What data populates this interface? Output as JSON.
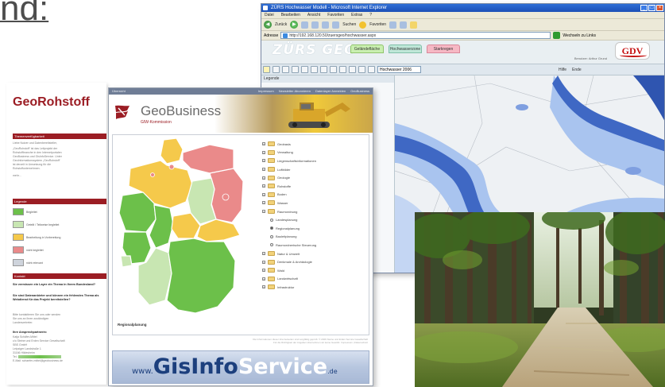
{
  "slide": {
    "heading_fragment": "nd:"
  },
  "zurs_window": {
    "title": "ZÜRS Hochwasser Modell - Microsoft Internet Explorer",
    "menu": [
      "Datei",
      "Bearbeiten",
      "Ansicht",
      "Favoriten",
      "Extras",
      "?"
    ],
    "toolbar": {
      "back_label": "Zurück",
      "search_label": "Suchen",
      "favorites_label": "Favoriten"
    },
    "address": {
      "label": "Adresse",
      "value": "http://192.168.120.50/zuersgeo/hochwasser.aspx",
      "links_label": "Wechseln zu  Links"
    },
    "app": {
      "logo": "ZÜRS GEO",
      "tabs": [
        "Geländefläche",
        "Hochwasserzone",
        "Starkregen"
      ],
      "partner_logo": "GDV",
      "user_text": "Benutzer: Arthur Grund"
    },
    "layer_select": "Hochwasser 2006",
    "panel_label": "Legende",
    "nav_labels": [
      "Hilfe",
      "Ende"
    ]
  },
  "georohstoff": {
    "brand": "GeoRohstoff",
    "sections": {
      "info_title": "Themenverfügbarkeit",
      "info_lines": [
        "Liebe Nutzer und Datenbereitsteller,",
        "„GeoRohstoff“ ist das Leitprojekt der",
        "Rohstoffbranche in den Internetportalen",
        "GeoBusiness und GisInfoService. Unter",
        "GeoInformationssystem „GeoRohstoff“",
        "ist derzeit in Umsetzung für die",
        "Rohstoffunternehmen."
      ],
      "more_link": "mehr...",
      "legend_title": "Legende",
      "legend": [
        {
          "label": "Begleitet",
          "color": "#6cc04a"
        },
        {
          "label": "Geteilt / Teilweise begleitet",
          "color": "#c8e6b2"
        },
        {
          "label": "Bearbeitung in Vorbereitung",
          "color": "#f5c94b"
        },
        {
          "label": "nicht begleitet",
          "color": "#ea8a8a"
        },
        {
          "label": "nicht relevant",
          "color": "#cfd4dc"
        }
      ],
      "contact_title": "Kontakt",
      "contact_q1": "Sie vermissen ein Layer ein Thema in Ihrem Bundesland?",
      "contact_q2": "Sie sind Datenanbieter und können ein fehlendes Thema als Webdienst für das Projekt bereitstellen?",
      "contact_lines": [
        "Bitte kontaktieren Sie uns oder senden",
        "Sie uns an Ihren zuständigen",
        "Landesvertreter."
      ],
      "partner_title": "Ihre Ansprechpartnerin:",
      "partner_lines": [
        "Katja Schäfer-Mittel",
        "c/o Steine und Erden Service Gesellschaft",
        "SBS GmbH",
        "Leipziger Landstraße 1",
        "31166 Hildesheim",
        "Tel.:",
        "E-Mail: schaefer-mittel@geobusiness.de"
      ]
    }
  },
  "geobusiness": {
    "topbar_left": "Übersicht",
    "topbar_right": [
      "Impressum",
      "Newsletter Abonnieren",
      "Datenlayer Anmelden",
      "GeoBusiness"
    ],
    "name": "GeoBusiness",
    "subtitle": "GIW-Kommission",
    "map_caption": "Regionalplanung",
    "tree": [
      {
        "label": "Geobasis",
        "level": 0
      },
      {
        "label": "Verwaltung",
        "level": 0
      },
      {
        "label": "Liegenschaftsinformationen",
        "level": 0
      },
      {
        "label": "Luftbilder",
        "level": 0
      },
      {
        "label": "Geologie",
        "level": 0
      },
      {
        "label": "Rohstoffe",
        "level": 0
      },
      {
        "label": "Boden",
        "level": 0
      },
      {
        "label": "Wasser",
        "level": 0
      },
      {
        "label": "Raumordnung",
        "level": 0
      },
      {
        "label": "Landesplanung",
        "level": 1,
        "checked": false
      },
      {
        "label": "Regionalplanung",
        "level": 1,
        "checked": true
      },
      {
        "label": "Bauleitplanung",
        "level": 1,
        "checked": false
      },
      {
        "label": "Raumordnerische Steuerung",
        "level": 1,
        "checked": false
      },
      {
        "label": "Natur & Umwelt",
        "level": 0
      },
      {
        "label": "Denkmale & Archäologie",
        "level": 0
      },
      {
        "label": "Wald",
        "level": 0
      },
      {
        "label": "Landwirtschaft",
        "level": 0
      },
      {
        "label": "Infrastruktur",
        "level": 0
      }
    ],
    "footer": [
      "Die Informationen dieser Internetseiten sind sorgfältig geprüft. © 2006 Steine und Erden Service Gesellschaft",
      "Für die Richtigkeit der Angaben übernehmen wir keine Gewähr. Impressum | Datenschutz"
    ],
    "banner": {
      "www": "www.",
      "info": "GisInfo",
      "service": "Service",
      "tld": ".de"
    }
  },
  "colors": {
    "geo_red": "#9b1d24",
    "state_green": "#6cc04a",
    "state_light_green": "#c8e6b2",
    "state_yellow": "#f5c94b",
    "state_red": "#ea8a8a",
    "flood_dark": "#3f68c4",
    "flood_light": "#a9c4ef"
  },
  "icons": [
    "shield-logo-icon",
    "folder-icon",
    "plus-expander-icon",
    "radio-icon",
    "back-arrow-icon",
    "forward-arrow-icon",
    "star-icon",
    "folder-toolbar-icon",
    "go-icon"
  ]
}
